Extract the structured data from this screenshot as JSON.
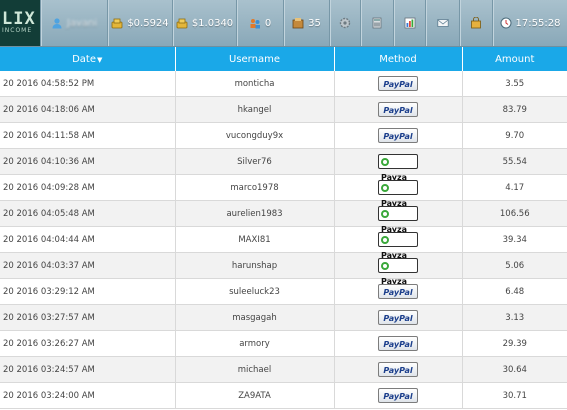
{
  "header": {
    "logo_text_top": "LIX",
    "logo_text_bottom": "INCOME",
    "username": "Javani",
    "balance_main": "$0.5924",
    "balance_purchase": "$1.0340",
    "referrals": "0",
    "messages_count": "35",
    "clock": "17:55:28"
  },
  "table": {
    "columns": [
      "Date",
      "Username",
      "Method",
      "Amount"
    ],
    "sort_indicator": "▼",
    "rows": [
      {
        "date": "20 2016 04:58:52 PM",
        "username": "monticha",
        "method": "PayPal",
        "amount": "3.55"
      },
      {
        "date": "20 2016 04:18:06 AM",
        "username": "hkangel",
        "method": "PayPal",
        "amount": "83.79"
      },
      {
        "date": "20 2016 04:11:58 AM",
        "username": "vucongduy9x",
        "method": "PayPal",
        "amount": "9.70"
      },
      {
        "date": "20 2016 04:10:36 AM",
        "username": "Silver76",
        "method": "Payza",
        "amount": "55.54"
      },
      {
        "date": "20 2016 04:09:28 AM",
        "username": "marco1978",
        "method": "Payza",
        "amount": "4.17"
      },
      {
        "date": "20 2016 04:05:48 AM",
        "username": "aurelien1983",
        "method": "Payza",
        "amount": "106.56"
      },
      {
        "date": "20 2016 04:04:44 AM",
        "username": "MAXI81",
        "method": "Payza",
        "amount": "39.34"
      },
      {
        "date": "20 2016 04:03:37 AM",
        "username": "harunshap",
        "method": "Payza",
        "amount": "5.06"
      },
      {
        "date": "20 2016 03:29:12 AM",
        "username": "suleeluck23",
        "method": "PayPal",
        "amount": "6.48"
      },
      {
        "date": "20 2016 03:27:57 AM",
        "username": "masgagah",
        "method": "PayPal",
        "amount": "3.13"
      },
      {
        "date": "20 2016 03:26:27 AM",
        "username": "armory",
        "method": "PayPal",
        "amount": "29.39"
      },
      {
        "date": "20 2016 03:24:57 AM",
        "username": "michael",
        "method": "PayPal",
        "amount": "30.64"
      },
      {
        "date": "20 2016 03:24:00 AM",
        "username": "ZA9ATA",
        "method": "PayPal",
        "amount": "30.71"
      }
    ]
  },
  "colors": {
    "header_bg": "#1aa8e8",
    "topbar_bg": "#98b3c1",
    "logo_bg": "#123d37",
    "paypal_blue": "#1c3f8c",
    "payza_green": "#3aa83a"
  },
  "icons": [
    "user-icon",
    "money-bag-icon",
    "money-bag-icon",
    "referrals-icon",
    "banner-icon",
    "settings-icon",
    "calculator-icon",
    "stats-icon",
    "mail-icon",
    "shop-icon",
    "clock-icon"
  ]
}
